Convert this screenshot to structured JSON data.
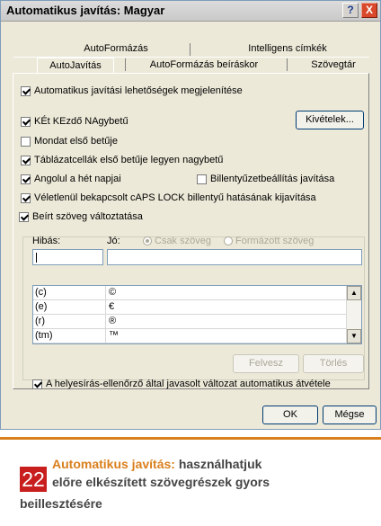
{
  "window": {
    "title": "Automatikus javítás: Magyar",
    "help_glyph": "?",
    "close_glyph": "X"
  },
  "tabs": {
    "row1": [
      "AutoFormázás",
      "Intelligens címkék"
    ],
    "row2": [
      "AutoJavítás",
      "AutoFormázás beíráskor",
      "Szövegtár"
    ],
    "active": "AutoJavítás"
  },
  "options": {
    "show_buttons": "Automatikus javítási lehetőségek megjelenítése",
    "two_initial_caps": "KÉt KEzdő NAgybetű",
    "sentence_first": "Mondat első betűje",
    "table_cells": "Táblázatcellák első betűje legyen nagybetű",
    "days": "Angolul a hét napjai",
    "keyboard_setting": "Billentyűzetbeállítás javítása",
    "caps_lock": "Véletlenül bekapcsolt cAPS LOCK billentyű hatásának kijavítása",
    "replace_text": "Beírt szöveg változtatása",
    "spelling_suggestions": "A helyesírás-ellenőrző által javasolt változat automatikus átvétele"
  },
  "buttons": {
    "exceptions": "Kivételek...",
    "add": "Felvesz",
    "delete": "Törlés",
    "ok": "OK",
    "cancel": "Mégse"
  },
  "replace": {
    "wrong_label": "Hibás:",
    "right_label": "Jó:",
    "plain_text": "Csak szöveg",
    "formatted_text": "Formázott szöveg",
    "wrong_value": "",
    "right_value": ""
  },
  "list": [
    {
      "from": "(c)",
      "to": "©"
    },
    {
      "from": "(e)",
      "to": "€"
    },
    {
      "from": "(r)",
      "to": "®"
    },
    {
      "from": "(tm)",
      "to": "™"
    }
  ],
  "caption": {
    "number": "22",
    "highlight": "Automatikus javítás:",
    "line1_rest": " használhatjuk",
    "line2": "előre elkészített szövegrészek gyors",
    "line3": "beillesztésére",
    "accent_color": "#d97f1c",
    "badge_color": "#c81e1e"
  }
}
